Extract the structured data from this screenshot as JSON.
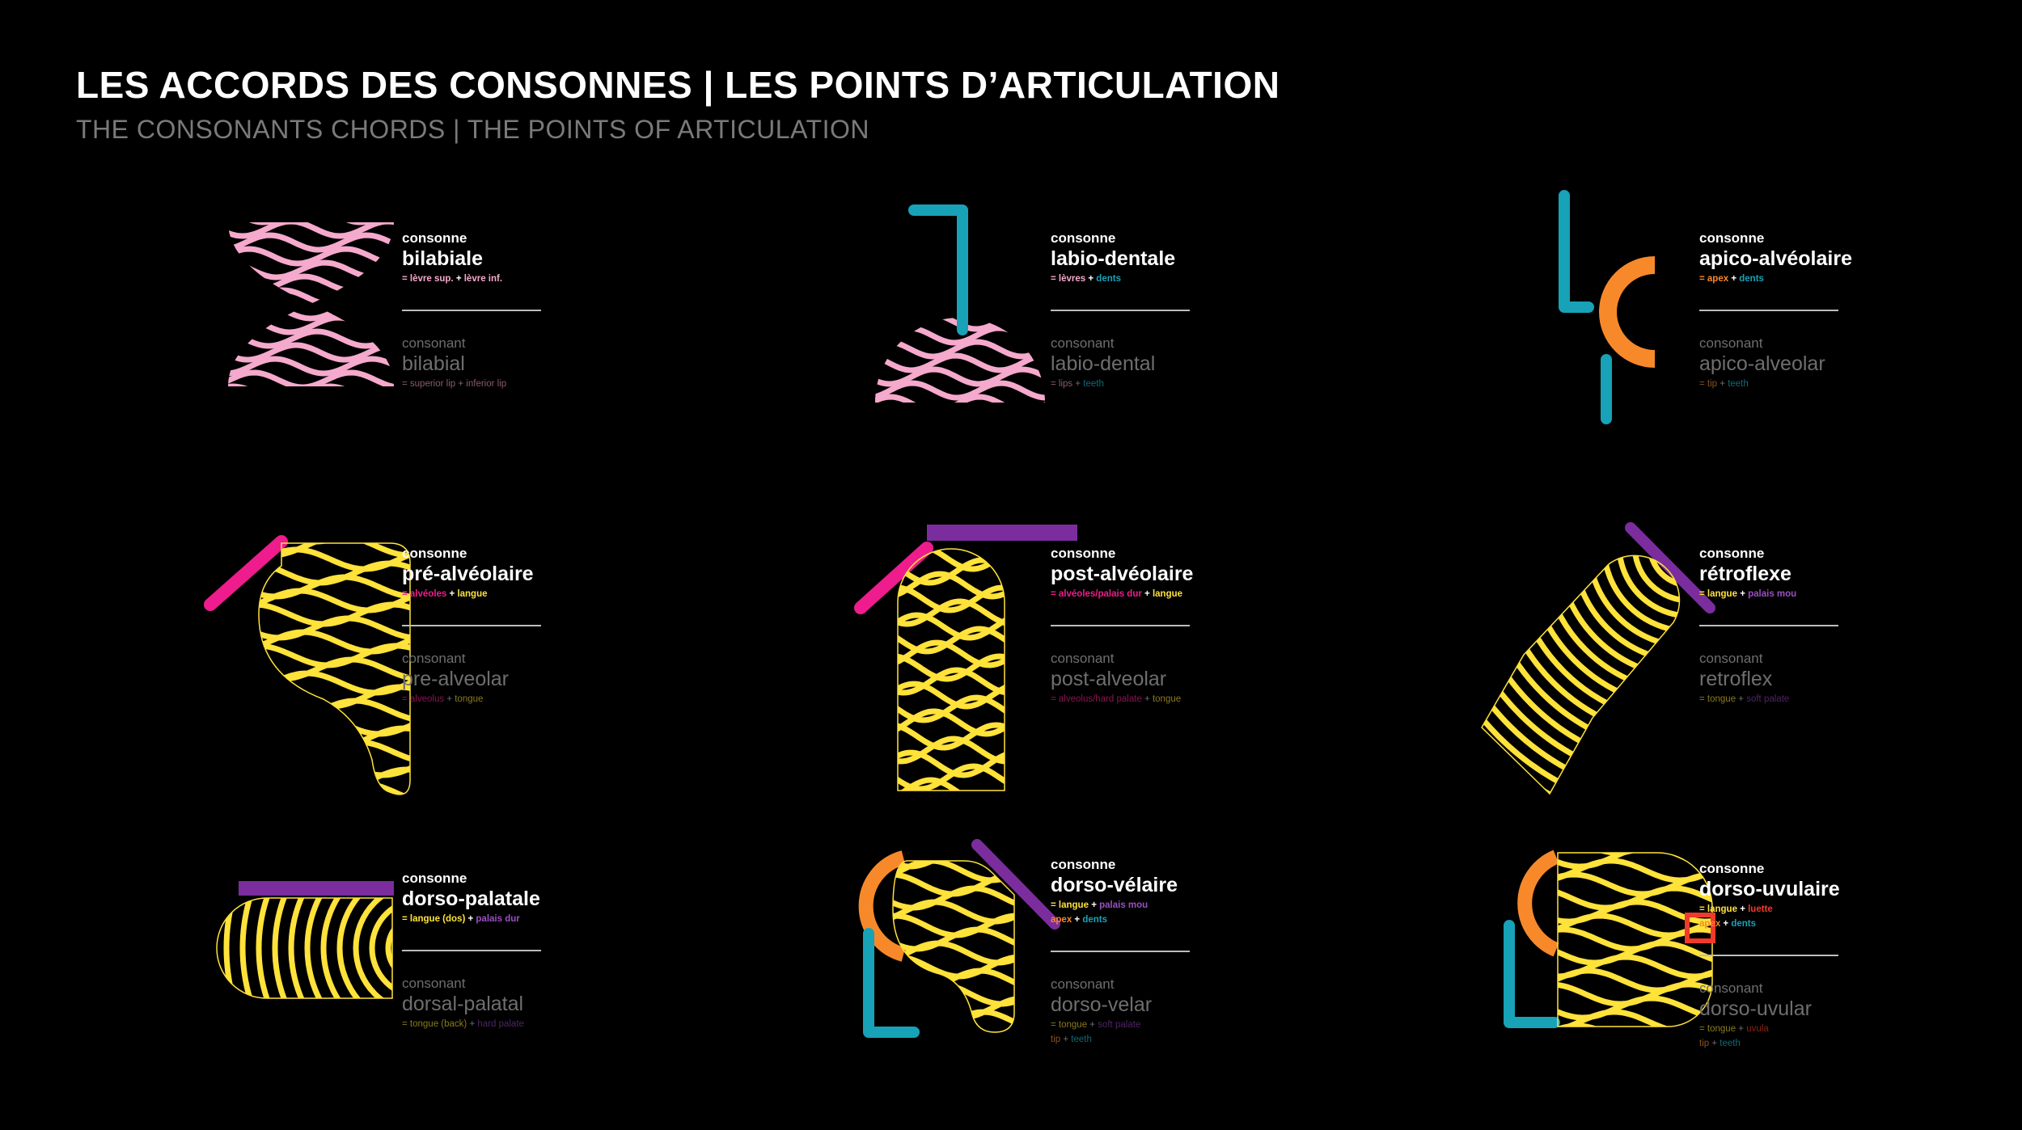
{
  "header": {
    "title": "LES ACCORDS DES CONSONNES | LES POINTS D’ARTICULATION",
    "subtitle": "THE CONSONANTS CHORDS | THE POINTS OF ARTICULATION"
  },
  "colors": {
    "pink": "#f5a9cc",
    "yellow": "#ffe23a",
    "teal": "#17a2b8",
    "orange": "#f7892a",
    "magenta": "#ee1c8c",
    "purple": "#7b2d9e",
    "red": "#ef3a2c",
    "background": "#000000"
  },
  "cards": [
    {
      "id": "bilabial",
      "fr": {
        "label": "consonne",
        "name": "bilabiale",
        "parts": [
          {
            "text": "= lèvre sup.",
            "color": "#f5a9cc"
          },
          {
            "text": "+",
            "color": "plus"
          },
          {
            "text": "lèvre inf.",
            "color": "#f5a9cc"
          }
        ]
      },
      "en": {
        "label": "consonant",
        "name": "bilabial",
        "parts": [
          {
            "text": "= superior lip",
            "color": "#8a5a72"
          },
          {
            "text": "+",
            "color": "plus"
          },
          {
            "text": "inferior lip",
            "color": "#8a5a72"
          }
        ]
      }
    },
    {
      "id": "labio-dental",
      "fr": {
        "label": "consonne",
        "name": "labio-dentale",
        "parts": [
          {
            "text": "= lèvres",
            "color": "#f5a9cc"
          },
          {
            "text": "+",
            "color": "plus"
          },
          {
            "text": "dents",
            "color": "#17a2b8"
          }
        ]
      },
      "en": {
        "label": "consonant",
        "name": "labio-dental",
        "parts": [
          {
            "text": "= lips",
            "color": "#8a5a72"
          },
          {
            "text": "+",
            "color": "plus"
          },
          {
            "text": "teeth",
            "color": "#0f6a78"
          }
        ]
      }
    },
    {
      "id": "apico-alveolar",
      "fr": {
        "label": "consonne",
        "name": "apico-alvéolaire",
        "parts": [
          {
            "text": "= apex",
            "color": "#f7892a"
          },
          {
            "text": "+",
            "color": "plus"
          },
          {
            "text": "dents",
            "color": "#17a2b8"
          }
        ]
      },
      "en": {
        "label": "consonant",
        "name": "apico-alveolar",
        "parts": [
          {
            "text": "= tip",
            "color": "#8a5222"
          },
          {
            "text": "+",
            "color": "plus"
          },
          {
            "text": "teeth",
            "color": "#0f6a78"
          }
        ]
      }
    },
    {
      "id": "pre-alveolar",
      "fr": {
        "label": "consonne",
        "name": "pré-alvéolaire",
        "parts": [
          {
            "text": "= alvéoles",
            "color": "#ee1c8c"
          },
          {
            "text": "+",
            "color": "plus"
          },
          {
            "text": "langue",
            "color": "#ffe23a"
          }
        ]
      },
      "en": {
        "label": "consonant",
        "name": "pre-alveolar",
        "parts": [
          {
            "text": "= alveolus",
            "color": "#8a1452"
          },
          {
            "text": "+",
            "color": "plus"
          },
          {
            "text": "tongue",
            "color": "#8a7a1e"
          }
        ]
      }
    },
    {
      "id": "post-alveolar",
      "fr": {
        "label": "consonne",
        "name": "post-alvéolaire",
        "parts": [
          {
            "text": "= alvéoles/palais dur",
            "color": "#ee1c8c"
          },
          {
            "text": "+",
            "color": "plus"
          },
          {
            "text": "langue",
            "color": "#ffe23a"
          }
        ]
      },
      "en": {
        "label": "consonant",
        "name": "post-alveolar",
        "parts": [
          {
            "text": "= alveolus/hard palate",
            "color": "#8a1452"
          },
          {
            "text": "+",
            "color": "plus"
          },
          {
            "text": "tongue",
            "color": "#8a7a1e"
          }
        ]
      }
    },
    {
      "id": "retroflex",
      "fr": {
        "label": "consonne",
        "name": "rétroflexe",
        "parts": [
          {
            "text": "= langue",
            "color": "#ffe23a"
          },
          {
            "text": "+",
            "color": "plus"
          },
          {
            "text": "palais mou",
            "color": "#9b4fc4"
          }
        ]
      },
      "en": {
        "label": "consonant",
        "name": "retroflex",
        "parts": [
          {
            "text": "= tongue",
            "color": "#8a7a1e"
          },
          {
            "text": "+",
            "color": "plus"
          },
          {
            "text": "soft palate",
            "color": "#4f2466"
          }
        ]
      }
    },
    {
      "id": "dorsal-palatal",
      "fr": {
        "label": "consonne",
        "name": "dorso-palatale",
        "parts": [
          {
            "text": "= langue (dos)",
            "color": "#ffe23a"
          },
          {
            "text": "+",
            "color": "plus"
          },
          {
            "text": "palais dur",
            "color": "#9b4fc4"
          }
        ]
      },
      "en": {
        "label": "consonant",
        "name": "dorsal-palatal",
        "parts": [
          {
            "text": "= tongue (back)",
            "color": "#8a7a1e"
          },
          {
            "text": "+",
            "color": "plus"
          },
          {
            "text": "hard palate",
            "color": "#4f2466"
          }
        ]
      }
    },
    {
      "id": "dorso-velar",
      "fr": {
        "label": "consonne",
        "name": "dorso-vélaire",
        "parts": [
          {
            "text": "= langue",
            "color": "#ffe23a"
          },
          {
            "text": "+",
            "color": "plus"
          },
          {
            "text": "palais mou",
            "color": "#9b4fc4"
          }
        ],
        "parts2": [
          {
            "text": "apex",
            "color": "#f7892a"
          },
          {
            "text": "+",
            "color": "plus"
          },
          {
            "text": "dents",
            "color": "#17a2b8"
          }
        ]
      },
      "en": {
        "label": "consonant",
        "name": "dorso-velar",
        "parts": [
          {
            "text": "= tongue",
            "color": "#8a7a1e"
          },
          {
            "text": "+",
            "color": "plus"
          },
          {
            "text": "soft palate",
            "color": "#4f2466"
          }
        ],
        "parts2": [
          {
            "text": "tip",
            "color": "#8a5222"
          },
          {
            "text": "+",
            "color": "plus"
          },
          {
            "text": "teeth",
            "color": "#0f6a78"
          }
        ]
      }
    },
    {
      "id": "dorso-uvular",
      "fr": {
        "label": "consonne",
        "name": "dorso-uvulaire",
        "parts": [
          {
            "text": "= langue",
            "color": "#ffe23a"
          },
          {
            "text": "+",
            "color": "plus"
          },
          {
            "text": "luette",
            "color": "#ef3a2c"
          }
        ],
        "parts2": [
          {
            "text": "apex",
            "color": "#f7892a"
          },
          {
            "text": "+",
            "color": "plus"
          },
          {
            "text": "dents",
            "color": "#17a2b8"
          }
        ]
      },
      "en": {
        "label": "consonant",
        "name": "dorso-uvular",
        "parts": [
          {
            "text": "= tongue",
            "color": "#8a7a1e"
          },
          {
            "text": "+",
            "color": "plus"
          },
          {
            "text": "uvula",
            "color": "#8a2218"
          }
        ],
        "parts2": [
          {
            "text": "tip",
            "color": "#8a5222"
          },
          {
            "text": "+",
            "color": "plus"
          },
          {
            "text": "teeth",
            "color": "#0f6a78"
          }
        ]
      }
    }
  ]
}
